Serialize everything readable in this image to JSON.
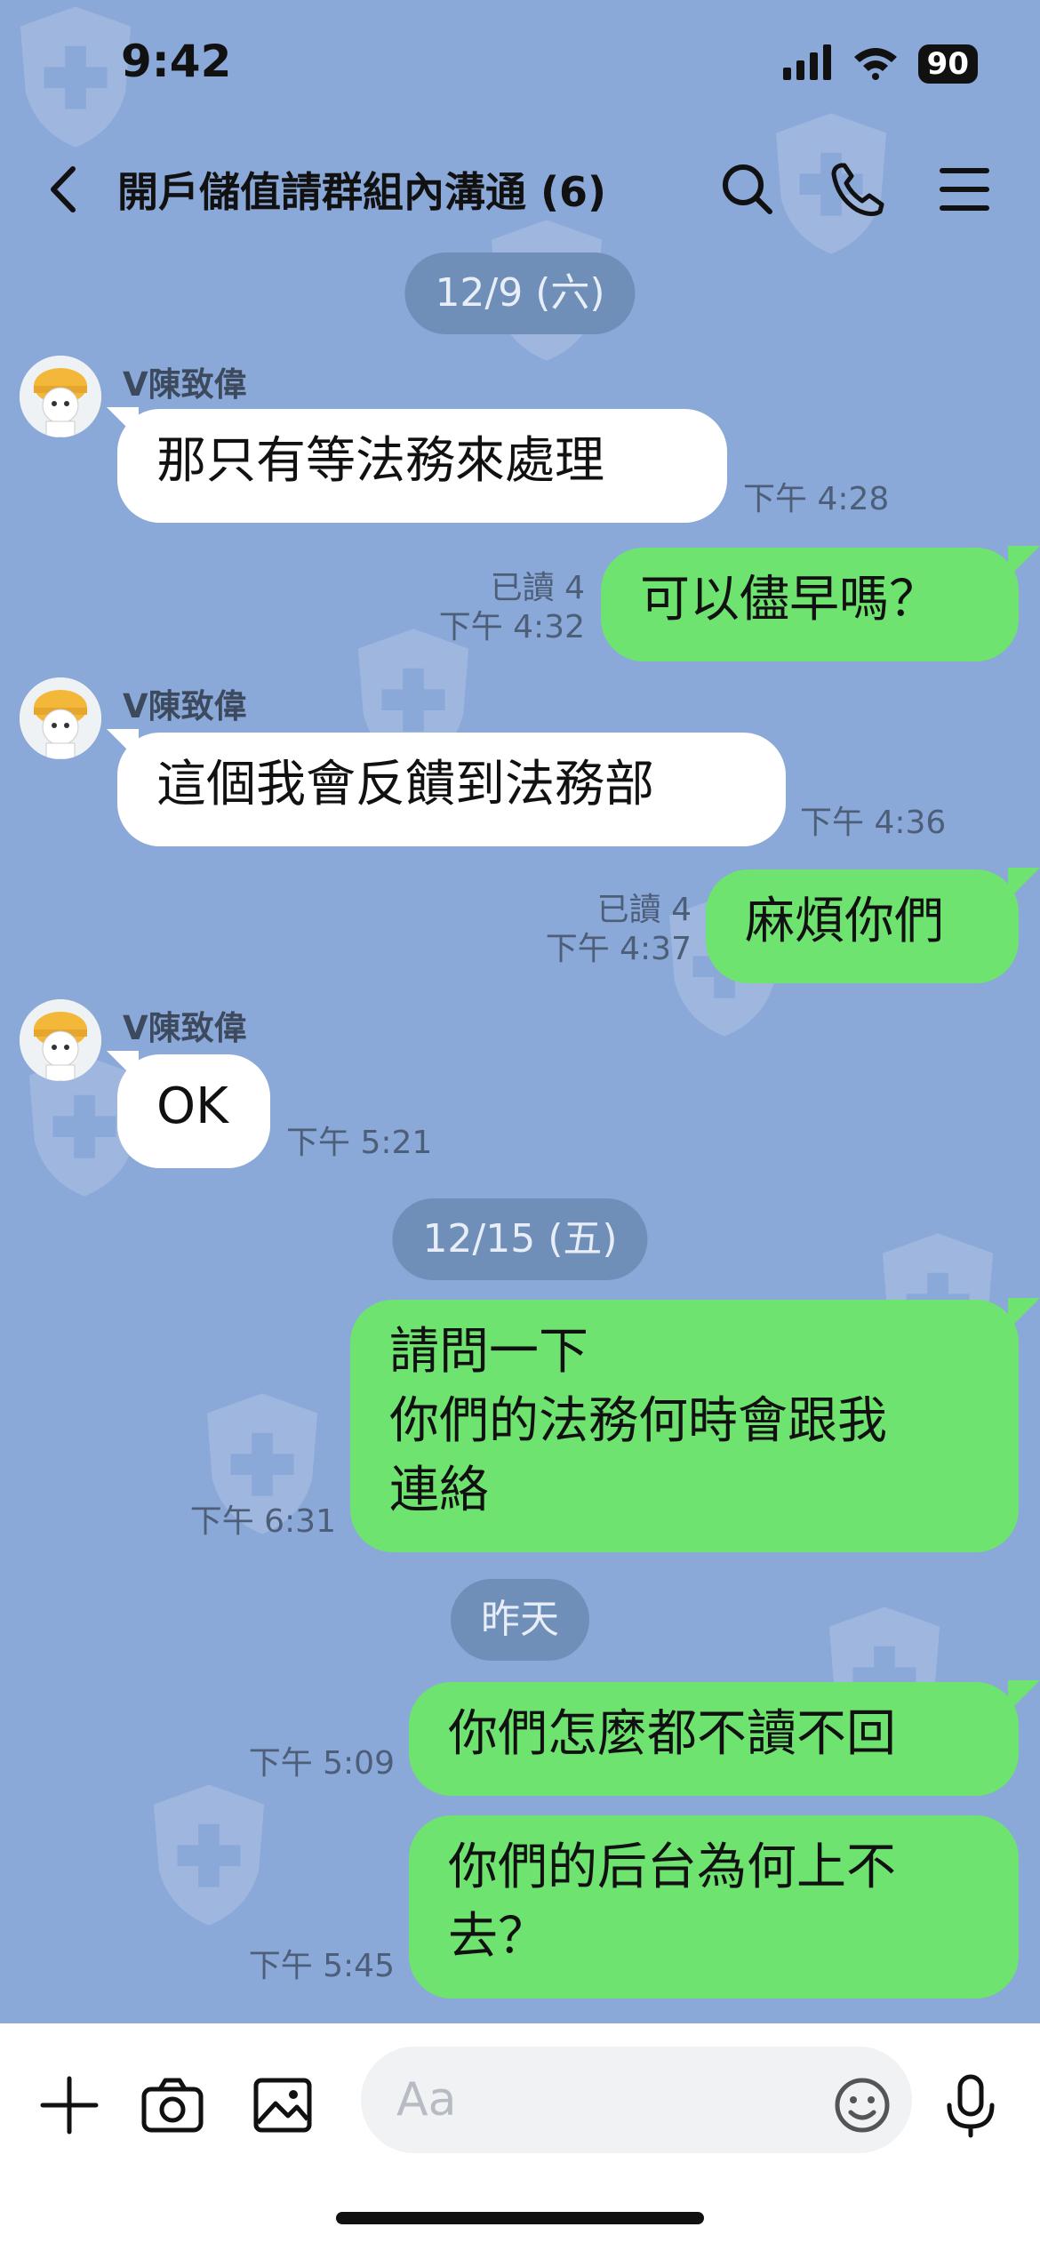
{
  "status_bar": {
    "time": "9:42",
    "battery": "90"
  },
  "header": {
    "title": "開戶儲值請群組內溝通 (6)"
  },
  "chat": {
    "date_1": "12/9 (六)",
    "date_2": "12/15 (五)",
    "date_3": "昨天",
    "sender": "V陳致偉",
    "msg1": {
      "text": "那只有等法務來處理",
      "time": "下午 4:28"
    },
    "msg2": {
      "text": "可以儘早嗎？",
      "read": "已讀 4",
      "time": "下午 4:32"
    },
    "msg3": {
      "text": "這個我會反饋到法務部",
      "time": "下午 4:36"
    },
    "msg4": {
      "text": "麻煩你們",
      "read": "已讀 4",
      "time": "下午 4:37"
    },
    "msg5": {
      "text": "OK",
      "time": "下午 5:21"
    },
    "msg6": {
      "line1": "請問一下",
      "line2": "你們的法務何時會跟我",
      "line3": "連絡",
      "time": "下午 6:31"
    },
    "msg7": {
      "text": "你們怎麼都不讀不回",
      "time": "下午 5:09"
    },
    "msg8": {
      "line1": "你們的后台為何上不",
      "line2": "去？",
      "time": "下午 5:45"
    }
  },
  "input": {
    "placeholder": "Aa"
  },
  "icons": [
    "back-arrow-icon",
    "search-icon",
    "phone-icon",
    "menu-icon",
    "plus-icon",
    "camera-icon",
    "image-icon",
    "emoji-icon",
    "microphone-icon"
  ],
  "colors": {
    "background": "#8aa8d8",
    "outgoing": "#6fe36f",
    "incoming": "#ffffff",
    "pill": "#6f8fb9"
  }
}
